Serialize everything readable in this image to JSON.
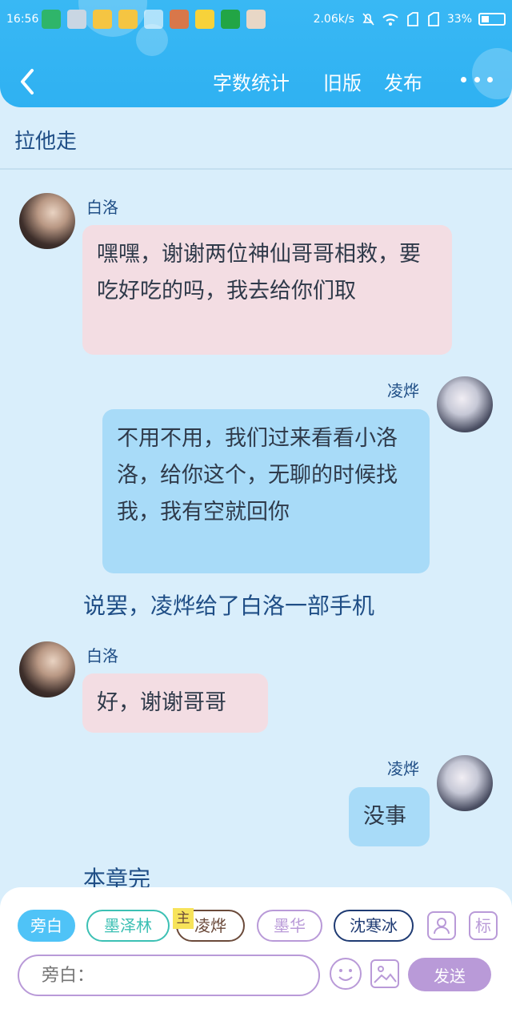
{
  "status_bar": {
    "time": "16:56",
    "network_speed": "2.06k/s",
    "battery": "33%",
    "battery_level": 0.33
  },
  "nav": {
    "word_count": "字数统计",
    "old_version": "旧版",
    "publish": "发布"
  },
  "chapter_title": "拉他走",
  "messages": [
    {
      "type": "left",
      "name": "白洛",
      "text": "嘿嘿，谢谢两位神仙哥哥相救，要吃好吃的吗，我去给你们取"
    },
    {
      "type": "right",
      "name": "凌烨",
      "text": "不用不用，我们过来看看小洛洛，给你这个，无聊的时候找我，我有空就回你"
    },
    {
      "type": "narration",
      "text": "说罢，凌烨给了白洛一部手机"
    },
    {
      "type": "left",
      "name": "白洛",
      "text": "好，谢谢哥哥"
    },
    {
      "type": "right",
      "name": "凌烨",
      "text": "没事"
    },
    {
      "type": "narration",
      "text": "本章完"
    }
  ],
  "bottom_bar": {
    "roles": [
      "旁白",
      "墨泽林",
      "凌烨",
      "墨华",
      "沈寒冰"
    ],
    "main_tag": "主",
    "label_btn": "标",
    "input_placeholder": "旁白：",
    "send": "发送"
  }
}
